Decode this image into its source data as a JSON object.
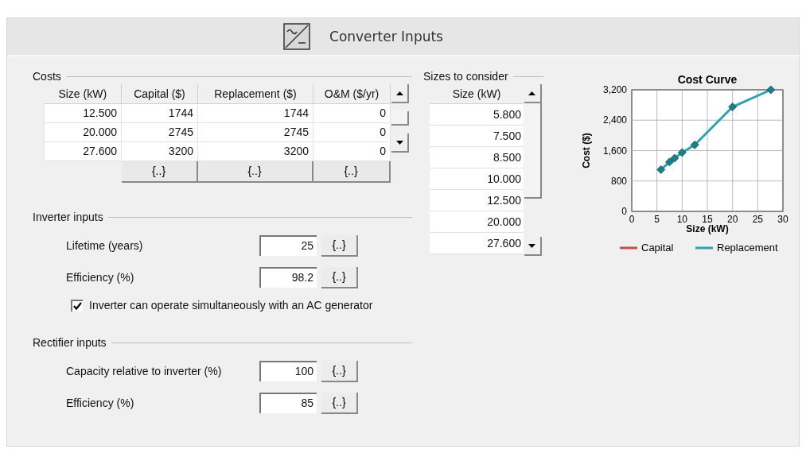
{
  "header": {
    "title": "Converter Inputs"
  },
  "costs": {
    "title": "Costs",
    "columns": [
      "Size (kW)",
      "Capital ($)",
      "Replacement ($)",
      "O&M ($/yr)"
    ],
    "rows": [
      [
        "12.500",
        "1744",
        "1744",
        "0"
      ],
      [
        "20.000",
        "2745",
        "2745",
        "0"
      ],
      [
        "27.600",
        "3200",
        "3200",
        "0"
      ]
    ],
    "buttons": [
      "{..}",
      "{..}",
      "{..}"
    ]
  },
  "sizes": {
    "title": "Sizes to consider",
    "column": "Size (kW)",
    "rows": [
      "5.800",
      "7.500",
      "8.500",
      "10.000",
      "12.500",
      "20.000",
      "27.600"
    ]
  },
  "chart": {
    "chart_data": {
      "type": "line",
      "title": "Cost Curve",
      "xlabel": "Size (kW)",
      "ylabel": "Cost ($)",
      "x": [
        5.8,
        7.5,
        8.5,
        10,
        12.5,
        20,
        27.6
      ],
      "series": [
        {
          "name": "Capital",
          "color": "#c0504d",
          "values": [
            null,
            null,
            null,
            null,
            null,
            null,
            null
          ]
        },
        {
          "name": "Replacement",
          "color": "#2fa3b0",
          "marker": "diamond",
          "values": [
            1100,
            1300,
            1400,
            1550,
            1750,
            2750,
            3200
          ]
        }
      ],
      "grid": true,
      "legend": true,
      "xlim": [
        0,
        30
      ],
      "ylim": [
        0,
        3200
      ],
      "xticks": [
        {
          "value": 0,
          "label": "0"
        },
        {
          "value": 5,
          "label": "5"
        },
        {
          "value": 10,
          "label": "10"
        },
        {
          "value": 15,
          "label": "15"
        },
        {
          "value": 20,
          "label": "20"
        },
        {
          "value": 25,
          "label": "25"
        },
        {
          "value": 30,
          "label": "30"
        }
      ],
      "yticks": [
        {
          "value": 0,
          "label": "0"
        },
        {
          "value": 800,
          "label": "800"
        },
        {
          "value": 1600,
          "label": "1,600"
        },
        {
          "value": 2400,
          "label": "2,400"
        },
        {
          "value": 3200,
          "label": "3,200"
        }
      ]
    }
  },
  "inverter": {
    "title": "Inverter inputs",
    "fields": [
      {
        "label": "Lifetime (years)",
        "value": "25",
        "button": "{..}"
      },
      {
        "label": "Efficiency (%)",
        "value": "98.2",
        "button": "{..}"
      }
    ],
    "checkbox": {
      "label": "Inverter can operate simultaneously with an AC generator",
      "checked": true
    }
  },
  "rectifier": {
    "title": "Rectifier inputs",
    "fields": [
      {
        "label": "Capacity relative to inverter (%)",
        "value": "100",
        "button": "{..}"
      },
      {
        "label": "Efficiency (%)",
        "value": "85",
        "button": "{..}"
      }
    ]
  }
}
